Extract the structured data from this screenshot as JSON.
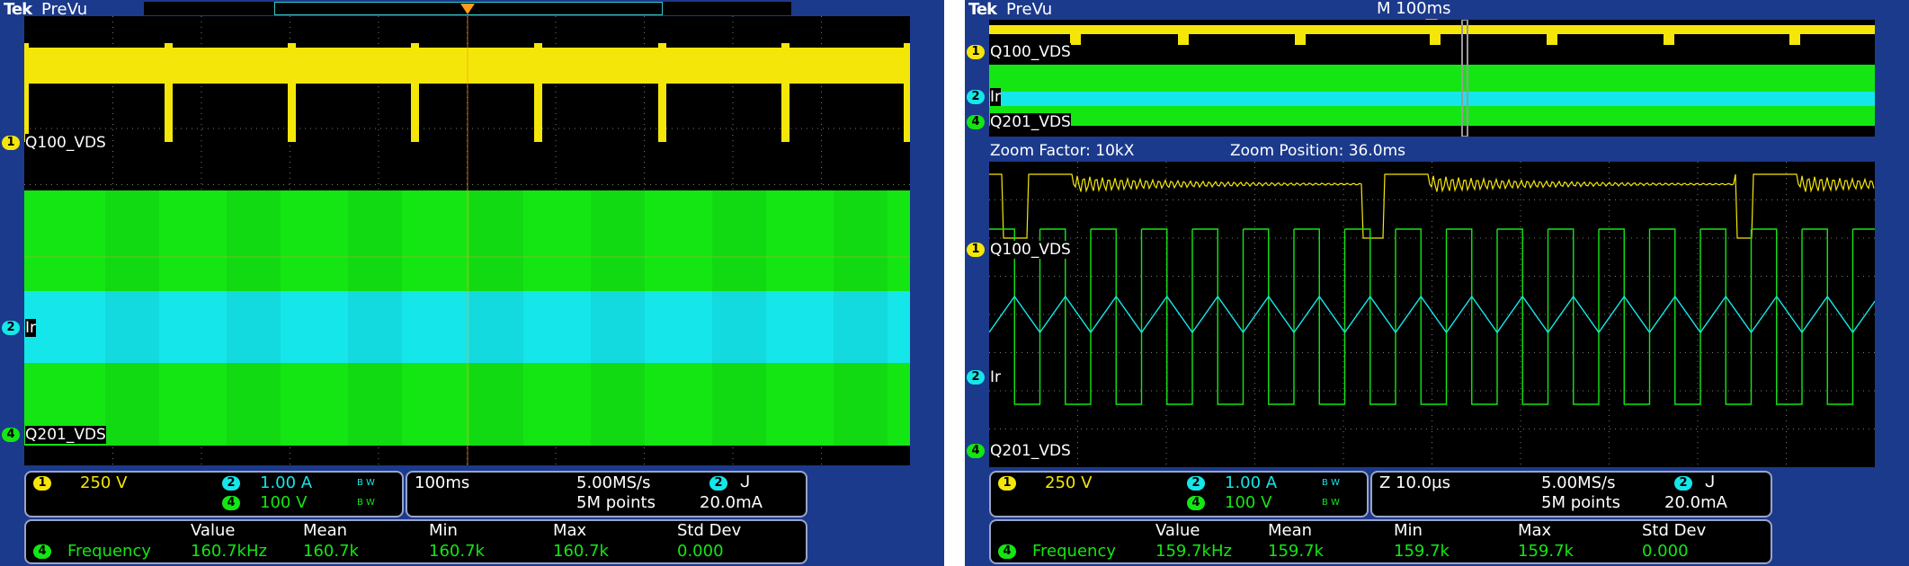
{
  "colors": {
    "frame": "#1c3a8c",
    "ch1": "#f5e60a",
    "ch2": "#15e6ea",
    "ch4": "#14e614",
    "grid": "#777777"
  },
  "left": {
    "brand": "Tek",
    "mode": "PreVu",
    "labels": {
      "ch1": "Q100_VDS",
      "ch2": "Ir",
      "ch4": "Q201_VDS"
    },
    "ch_numbers": {
      "ch1": "1",
      "ch2": "2",
      "ch4": "4"
    },
    "vertical": {
      "ch1_scale": "250 V",
      "ch2_scale": "1.00 A",
      "ch4_scale": "100 V",
      "bw": "B W"
    },
    "horizontal": {
      "timebase": "100ms",
      "rate": "5.00MS/s",
      "points": "5M points",
      "trig_level": "20.0mA",
      "trig_ch": "2"
    },
    "measure": {
      "headers": [
        "Value",
        "Mean",
        "Min",
        "Max",
        "Std Dev"
      ],
      "ch": "4",
      "name": "Frequency",
      "values": [
        "160.7kHz",
        "160.7k",
        "160.7k",
        "160.7k",
        "0.000"
      ]
    }
  },
  "right": {
    "brand": "Tek",
    "mode": "PreVu",
    "timebase_top": "M 100ms",
    "zoom_factor": "Zoom Factor: 10kX",
    "zoom_position": "Zoom Position: 36.0ms",
    "labels": {
      "ch1": "Q100_VDS",
      "ch2": "Ir",
      "ch4": "Q201_VDS"
    },
    "ch_numbers": {
      "ch1": "1",
      "ch2": "2",
      "ch4": "4"
    },
    "vertical": {
      "ch1_scale": "250 V",
      "ch2_scale": "1.00 A",
      "ch4_scale": "100 V",
      "bw": "B W"
    },
    "horizontal": {
      "timebase": "Z 10.0µs",
      "rate": "5.00MS/s",
      "points": "5M points",
      "trig_level": "20.0mA",
      "trig_ch": "2"
    },
    "measure": {
      "headers": [
        "Value",
        "Mean",
        "Min",
        "Max",
        "Std Dev"
      ],
      "ch": "4",
      "name": "Frequency",
      "values": [
        "159.7kHz",
        "159.7k",
        "159.7k",
        "159.7k",
        "0.000"
      ]
    }
  },
  "chart_data": [
    {
      "type": "line",
      "title": "",
      "series": [
        {
          "name": "Q100_VDS",
          "description": "250 V/div, periodic dips roughly every 136 ms"
        },
        {
          "name": "Ir",
          "description": "1.00 A/div, dense envelope"
        },
        {
          "name": "Q201_VDS",
          "description": "100 V/div, dense envelope"
        }
      ],
      "timebase": "100ms/div",
      "grid": true,
      "frequency_khz": 160.7
    },
    {
      "type": "line",
      "title": "",
      "series": [
        {
          "name": "Q100_VDS",
          "description": "burst ringing waveform"
        },
        {
          "name": "Ir",
          "description": "triangular current wave"
        },
        {
          "name": "Q201_VDS",
          "description": "square wave"
        }
      ],
      "timebase": "10.0µs/div",
      "zoom_factor": "10kX",
      "zoom_position_ms": 36.0,
      "grid": true,
      "frequency_khz": 159.7
    }
  ]
}
